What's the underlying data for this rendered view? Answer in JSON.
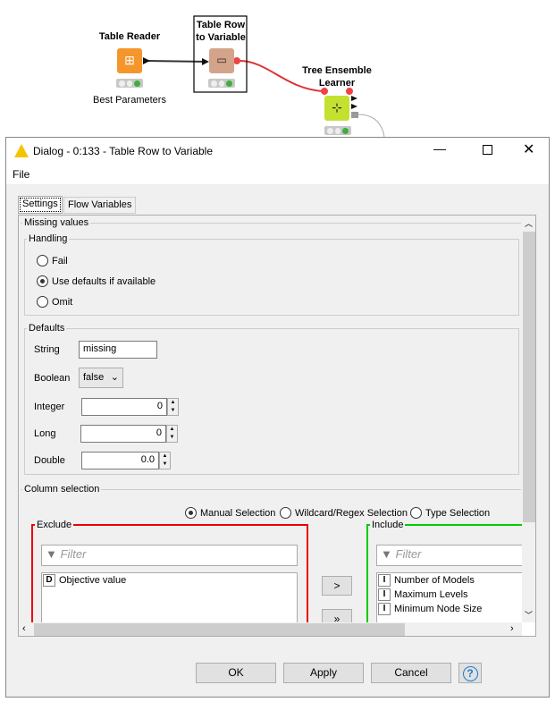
{
  "workflow": {
    "nodes": [
      {
        "title": "Table Reader",
        "subtitle": "Best Parameters",
        "color": "#f5962d"
      },
      {
        "title": "Table Row\nto Variable",
        "color": "#d3a489"
      },
      {
        "title": "Tree Ensemble\nLearner",
        "color": "#c4e031"
      }
    ]
  },
  "dialog": {
    "title": "Dialog - 0:133 - Table Row to Variable",
    "menu": [
      "File"
    ],
    "tabs": [
      "Settings",
      "Flow Variables"
    ],
    "active_tab": "Settings",
    "missing_values": {
      "legend": "Missing values",
      "handling_legend": "Handling",
      "options": [
        "Fail",
        "Use defaults if available",
        "Omit"
      ],
      "selected": "Use defaults if available",
      "defaults_legend": "Defaults",
      "fields": {
        "string_label": "String",
        "string_value": "missing",
        "boolean_label": "Boolean",
        "boolean_value": "false",
        "integer_label": "Integer",
        "integer_value": "0",
        "long_label": "Long",
        "long_value": "0",
        "double_label": "Double",
        "double_value": "0.0"
      }
    },
    "column_selection": {
      "legend": "Column selection",
      "modes": [
        "Manual Selection",
        "Wildcard/Regex Selection",
        "Type Selection"
      ],
      "selected_mode": "Manual Selection",
      "exclude": {
        "legend": "Exclude",
        "filter_placeholder": "Filter",
        "items": [
          {
            "type": "D",
            "name": "Objective value"
          }
        ]
      },
      "include": {
        "legend": "Include",
        "filter_placeholder": "Filter",
        "items": [
          {
            "type": "I",
            "name": "Number of Models"
          },
          {
            "type": "I",
            "name": "Maximum Levels"
          },
          {
            "type": "I",
            "name": "Minimum Node Size"
          }
        ]
      },
      "move_one": ">",
      "move_all": "»"
    },
    "buttons": {
      "ok": "OK",
      "apply": "Apply",
      "cancel": "Cancel",
      "help": "?"
    }
  }
}
